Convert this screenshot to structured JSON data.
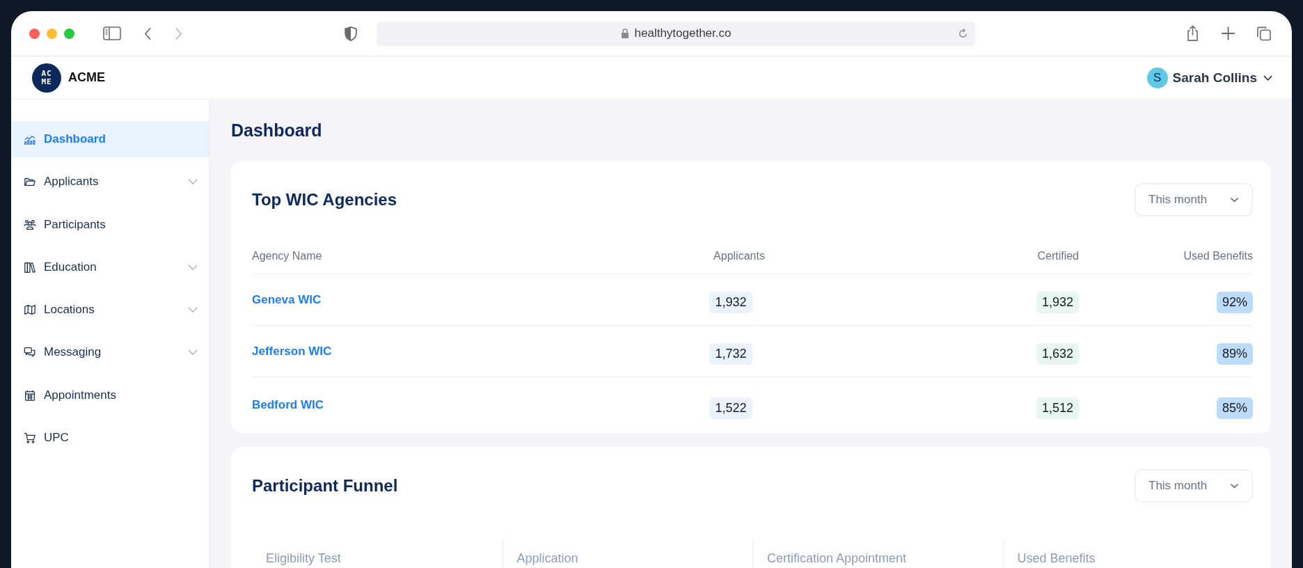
{
  "browser": {
    "url": "healthytogether.co"
  },
  "header": {
    "logo_text": [
      "AC",
      "ME"
    ],
    "brand": "ACME",
    "user": {
      "initial": "S",
      "name": "Sarah Collins"
    }
  },
  "sidebar": {
    "items": [
      {
        "label": "Dashboard",
        "selected": true,
        "expandable": false
      },
      {
        "label": "Applicants",
        "selected": false,
        "expandable": true
      },
      {
        "label": "Participants",
        "selected": false,
        "expandable": false
      },
      {
        "label": "Education",
        "selected": false,
        "expandable": true
      },
      {
        "label": "Locations",
        "selected": false,
        "expandable": true
      },
      {
        "label": "Messaging",
        "selected": false,
        "expandable": true
      },
      {
        "label": "Appointments",
        "selected": false,
        "expandable": false
      },
      {
        "label": "UPC",
        "selected": false,
        "expandable": false
      }
    ]
  },
  "page_title": "Dashboard",
  "top_agencies": {
    "title": "Top WIC Agencies",
    "period": "This month",
    "columns": [
      "Agency Name",
      "Applicants",
      "Certified",
      "Used Benefits"
    ],
    "rows": [
      {
        "name": "Geneva WIC",
        "applicants": "1,932",
        "certified": "1,932",
        "used_benefits": "92%"
      },
      {
        "name": "Jefferson WIC",
        "applicants": "1,732",
        "certified": "1,632",
        "used_benefits": "89%"
      },
      {
        "name": "Bedford WIC",
        "applicants": "1,522",
        "certified": "1,512",
        "used_benefits": "85%"
      }
    ]
  },
  "funnel": {
    "title": "Participant Funnel",
    "period": "This month",
    "stages": [
      "Eligibility Test",
      "Application",
      "Certification Appointment",
      "Used Benefits"
    ]
  }
}
